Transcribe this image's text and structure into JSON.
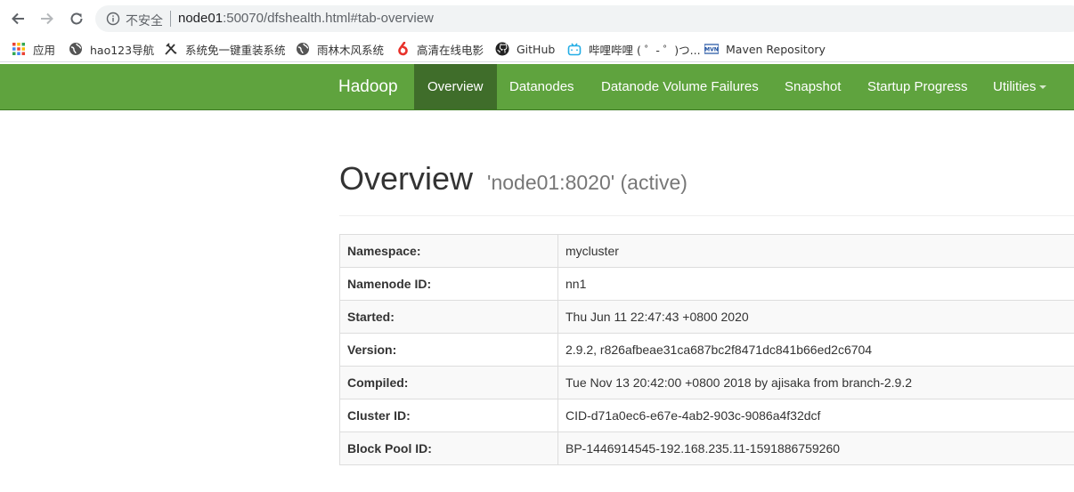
{
  "browser": {
    "security_label": "不安全",
    "url_host": "node01",
    "url_rest": ":50070/dfshealth.html#tab-overview",
    "bookmarks": [
      {
        "label": "应用",
        "icon": "apps-grid-icon"
      },
      {
        "label": "hao123导航",
        "icon": "globe-icon"
      },
      {
        "label": "系统免一键重装系统",
        "icon": "tool-icon"
      },
      {
        "label": "雨林木风系统",
        "icon": "globe-icon"
      },
      {
        "label": "高清在线电影",
        "icon": "six-logo-icon"
      },
      {
        "label": "GitHub",
        "icon": "github-icon"
      },
      {
        "label": "哔哩哔哩 ( ゜- ゜)つ...",
        "icon": "bilibili-icon"
      },
      {
        "label": "Maven Repository",
        "icon": "mvn-icon"
      }
    ]
  },
  "navbar": {
    "brand": "Hadoop",
    "items": [
      {
        "label": "Overview",
        "active": true
      },
      {
        "label": "Datanodes"
      },
      {
        "label": "Datanode Volume Failures"
      },
      {
        "label": "Snapshot"
      },
      {
        "label": "Startup Progress"
      },
      {
        "label": "Utilities",
        "dropdown": true
      }
    ]
  },
  "overview": {
    "title": "Overview",
    "subtitle": "'node01:8020' (active)",
    "rows": [
      {
        "key": "Namespace:",
        "value": "mycluster"
      },
      {
        "key": "Namenode ID:",
        "value": "nn1"
      },
      {
        "key": "Started:",
        "value": "Thu Jun 11 22:47:43 +0800 2020"
      },
      {
        "key": "Version:",
        "value": "2.9.2, r826afbeae31ca687bc2f8471dc841b66ed2c6704"
      },
      {
        "key": "Compiled:",
        "value": "Tue Nov 13 20:42:00 +0800 2018 by ajisaka from branch-2.9.2"
      },
      {
        "key": "Cluster ID:",
        "value": "CID-d71a0ec6-e67e-4ab2-903c-9086a4f32dcf"
      },
      {
        "key": "Block Pool ID:",
        "value": "BP-1446914545-192.168.235.11-1591886759260"
      }
    ]
  }
}
